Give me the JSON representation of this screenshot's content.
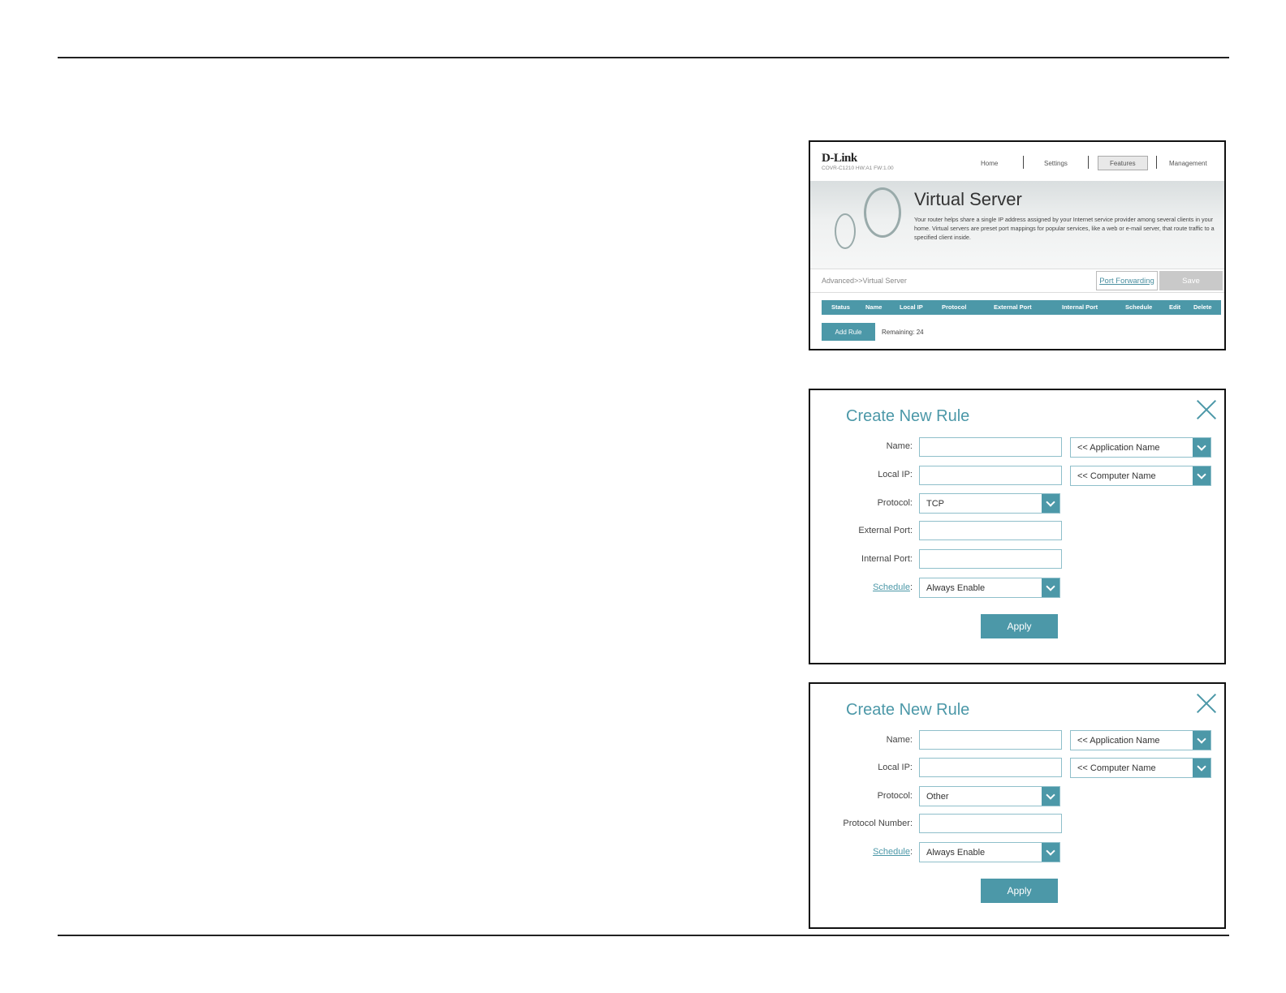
{
  "virtual_server": {
    "logo": "D-Link",
    "model": "COVR-C1210 HW:A1 FW:1.00",
    "nav": [
      "Home",
      "Settings",
      "Features",
      "Management"
    ],
    "title": "Virtual Server",
    "description": "Your router helps share a single IP address assigned by your Internet service provider among several clients in your home. Virtual servers are preset port mappings for popular services, like a web or e-mail server, that route traffic to a specified client inside.",
    "breadcrumb": "Advanced>>Virtual Server",
    "port_forwarding": "Port Forwarding",
    "save": "Save",
    "columns": [
      "Status",
      "Name",
      "Local IP",
      "Protocol",
      "External Port",
      "Internal Port",
      "Schedule",
      "Edit",
      "Delete"
    ],
    "add_rule": "Add Rule",
    "remaining": "Remaining: 24"
  },
  "rule_tcp": {
    "title": "Create New Rule",
    "name_label": "Name:",
    "local_ip_label": "Local IP:",
    "protocol_label": "Protocol:",
    "external_port_label": "External Port:",
    "internal_port_label": "Internal Port:",
    "schedule_label": "Schedule",
    "app_name": "<< Application Name",
    "computer_name": "<< Computer Name",
    "protocol_value": "TCP",
    "schedule_value": "Always Enable",
    "apply": "Apply"
  },
  "rule_other": {
    "title": "Create New Rule",
    "name_label": "Name:",
    "local_ip_label": "Local IP:",
    "protocol_label": "Protocol:",
    "protocol_number_label": "Protocol Number:",
    "schedule_label": "Schedule",
    "app_name": "<< Application Name",
    "computer_name": "<< Computer Name",
    "protocol_value": "Other",
    "schedule_value": "Always Enable",
    "apply": "Apply"
  }
}
